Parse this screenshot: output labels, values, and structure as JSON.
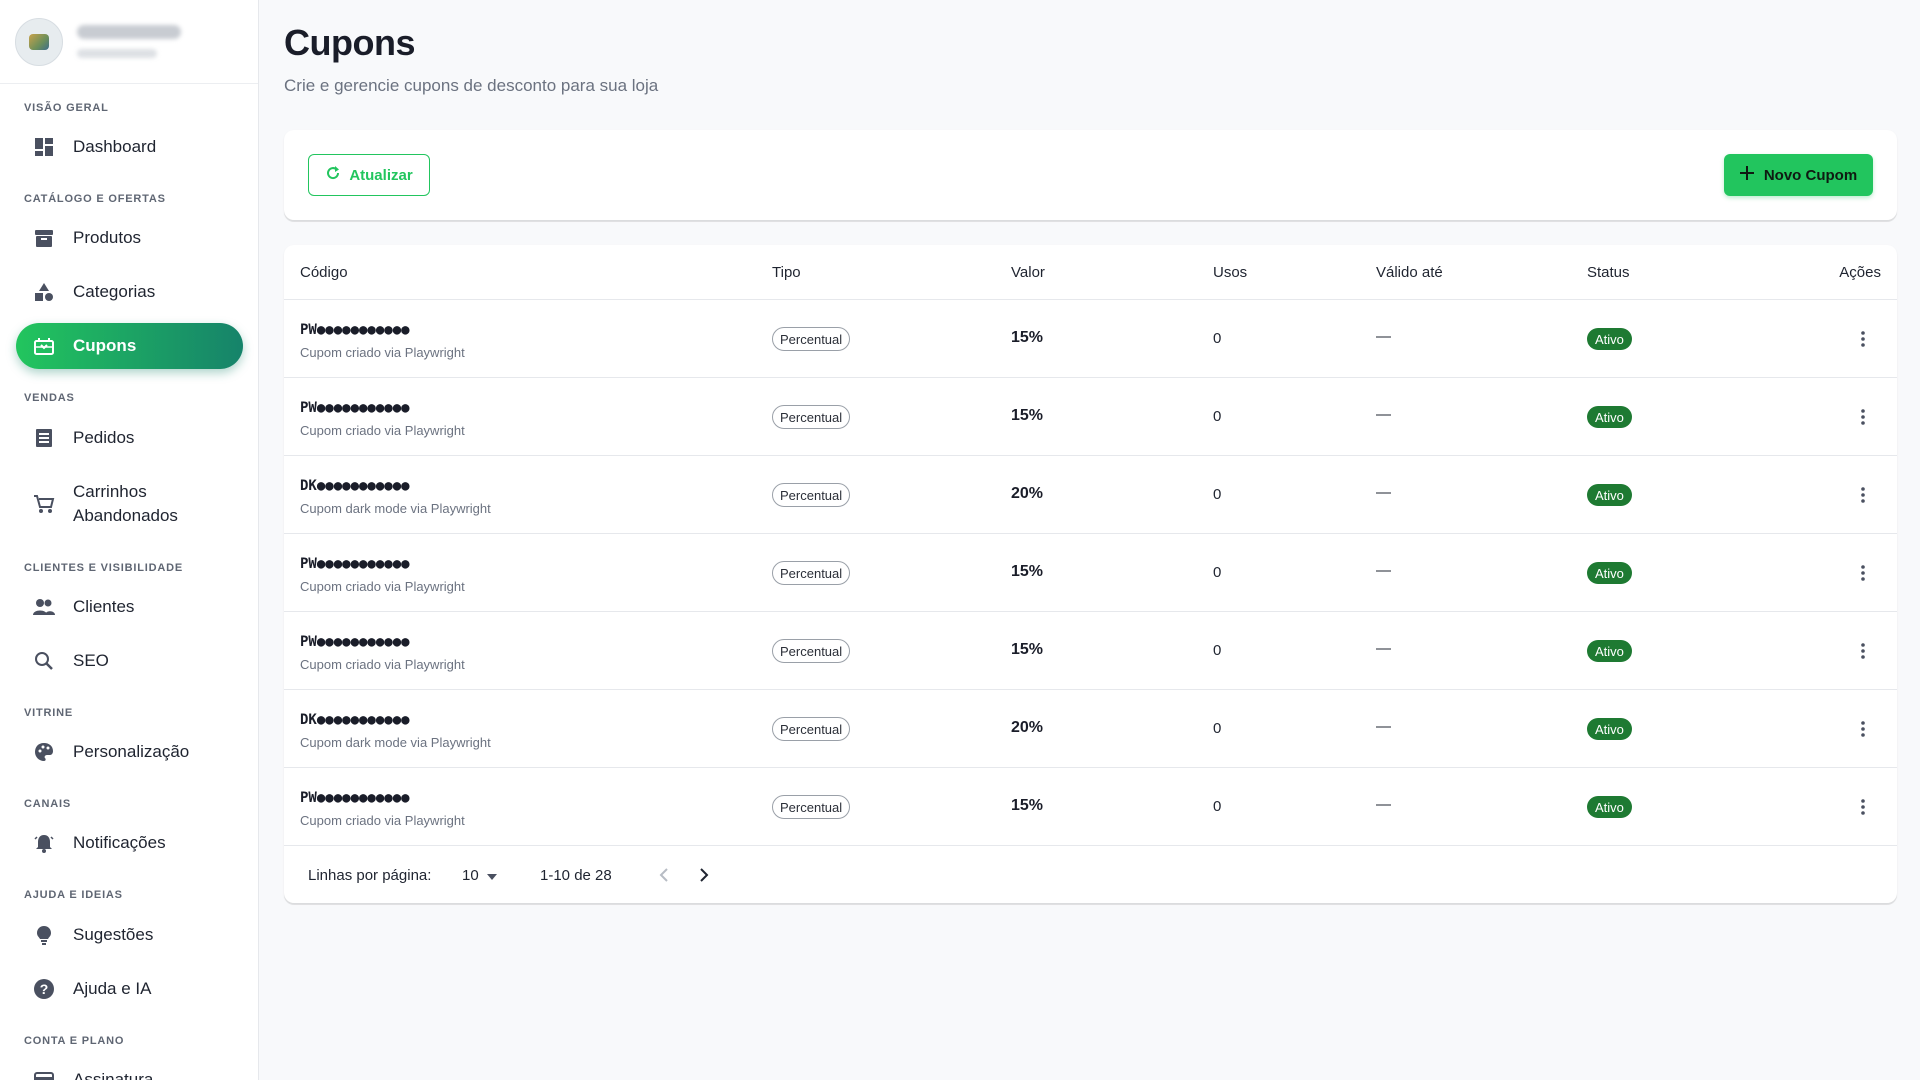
{
  "sidebar": {
    "sections": [
      {
        "label": "VISÃO GERAL"
      },
      {
        "label": "CATÁLOGO E OFERTAS"
      },
      {
        "label": "VENDAS"
      },
      {
        "label": "CLIENTES E VISIBILIDADE"
      },
      {
        "label": "VITRINE"
      },
      {
        "label": "CANAIS"
      },
      {
        "label": "AJUDA E IDEIAS"
      },
      {
        "label": "CONTA E PLANO"
      }
    ],
    "items": [
      {
        "label": "Dashboard",
        "icon": "dashboard-icon"
      },
      {
        "label": "Produtos",
        "icon": "archive-icon"
      },
      {
        "label": "Categorias",
        "icon": "shapes-icon"
      },
      {
        "label": "Cupons",
        "icon": "ticket-icon",
        "active": true
      },
      {
        "label": "Pedidos",
        "icon": "list-icon"
      },
      {
        "label": "Carrinhos",
        "label2": "Abandonados",
        "icon": "cart-icon"
      },
      {
        "label": "Clientes",
        "icon": "people-icon"
      },
      {
        "label": "SEO",
        "icon": "search-icon"
      },
      {
        "label": "Personalização",
        "icon": "palette-icon"
      },
      {
        "label": "Notificações",
        "icon": "bell-icon"
      },
      {
        "label": "Sugestões",
        "icon": "lightbulb-icon"
      },
      {
        "label": "Ajuda e IA",
        "icon": "help-icon"
      },
      {
        "label": "Assinatura",
        "icon": "card-icon"
      }
    ]
  },
  "header": {
    "title": "Cupons",
    "subtitle": "Crie e gerencie cupons de desconto para sua loja"
  },
  "toolbar": {
    "refresh_label": "Atualizar",
    "new_label": "Novo Cupom"
  },
  "table": {
    "columns": [
      "Código",
      "Tipo",
      "Valor",
      "Usos",
      "Válido até",
      "Status",
      "Ações"
    ],
    "rows": [
      {
        "code": "PW●●●●●●●●●●●",
        "desc": "Cupom criado via Playwright",
        "tipo": "Percentual",
        "valor": "15%",
        "usos": "0",
        "valido": "—",
        "status": "Ativo"
      },
      {
        "code": "PW●●●●●●●●●●●",
        "desc": "Cupom criado via Playwright",
        "tipo": "Percentual",
        "valor": "15%",
        "usos": "0",
        "valido": "—",
        "status": "Ativo"
      },
      {
        "code": "DK●●●●●●●●●●●",
        "desc": "Cupom dark mode via Playwright",
        "tipo": "Percentual",
        "valor": "20%",
        "usos": "0",
        "valido": "—",
        "status": "Ativo"
      },
      {
        "code": "PW●●●●●●●●●●●",
        "desc": "Cupom criado via Playwright",
        "tipo": "Percentual",
        "valor": "15%",
        "usos": "0",
        "valido": "—",
        "status": "Ativo"
      },
      {
        "code": "PW●●●●●●●●●●●",
        "desc": "Cupom criado via Playwright",
        "tipo": "Percentual",
        "valor": "15%",
        "usos": "0",
        "valido": "—",
        "status": "Ativo"
      },
      {
        "code": "DK●●●●●●●●●●●",
        "desc": "Cupom dark mode via Playwright",
        "tipo": "Percentual",
        "valor": "20%",
        "usos": "0",
        "valido": "—",
        "status": "Ativo"
      },
      {
        "code": "PW●●●●●●●●●●●",
        "desc": "Cupom criado via Playwright",
        "tipo": "Percentual",
        "valor": "15%",
        "usos": "0",
        "valido": "—",
        "status": "Ativo"
      }
    ]
  },
  "pagination": {
    "rows_label": "Linhas por página:",
    "rows_value": "10",
    "range": "1-10 de 28"
  },
  "colors": {
    "accent": "#22c55e",
    "accent_dark": "#16836a",
    "status_active": "#1e7a32"
  }
}
